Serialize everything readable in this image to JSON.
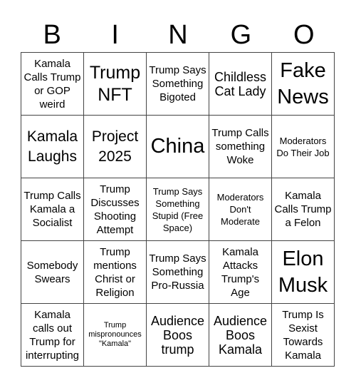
{
  "header": [
    "B",
    "I",
    "N",
    "G",
    "O"
  ],
  "cells": [
    {
      "text": "Kamala Calls Trump or GOP weird",
      "size": "s-md"
    },
    {
      "text": "Trump NFT",
      "size": "s-xxl"
    },
    {
      "text": "Trump Says Something Bigoted",
      "size": "s-md"
    },
    {
      "text": "Childless Cat Lady",
      "size": "s-lg"
    },
    {
      "text": "Fake News",
      "size": "s-huge"
    },
    {
      "text": "Kamala Laughs",
      "size": "s-xl"
    },
    {
      "text": "Project 2025",
      "size": "s-xl"
    },
    {
      "text": "China",
      "size": "s-huge"
    },
    {
      "text": "Trump Calls something Woke",
      "size": "s-md"
    },
    {
      "text": "Moderators Do Their Job",
      "size": "s-sm"
    },
    {
      "text": "Trump Calls Kamala a Socialist",
      "size": "s-md"
    },
    {
      "text": "Trump Discusses Shooting Attempt",
      "size": "s-md"
    },
    {
      "text": "Trump Says Something Stupid (Free Space)",
      "size": "s-sm"
    },
    {
      "text": "Moderators Don't Moderate",
      "size": "s-sm"
    },
    {
      "text": "Kamala Calls Trump a Felon",
      "size": "s-md"
    },
    {
      "text": "Somebody Swears",
      "size": "s-md"
    },
    {
      "text": "Trump mentions Christ or Religion",
      "size": "s-md"
    },
    {
      "text": "Trump Says Something Pro-Russia",
      "size": "s-md"
    },
    {
      "text": "Kamala Attacks Trump's Age",
      "size": "s-md"
    },
    {
      "text": "Elon Musk",
      "size": "s-huge"
    },
    {
      "text": "Kamala calls out Trump for interrupting",
      "size": "s-md"
    },
    {
      "text": "Trump mispronounces \"Kamala\"",
      "size": "s-xs"
    },
    {
      "text": "Audience Boos trump",
      "size": "s-lg"
    },
    {
      "text": "Audience Boos Kamala",
      "size": "s-lg"
    },
    {
      "text": "Trump Is Sexist Towards Kamala",
      "size": "s-md"
    }
  ]
}
